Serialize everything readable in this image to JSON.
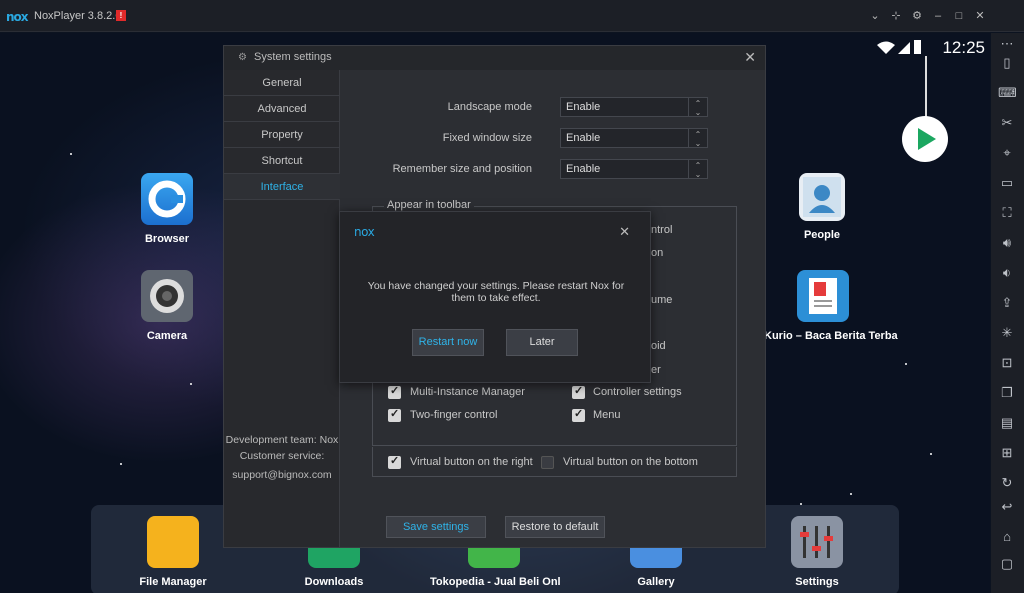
{
  "window": {
    "logo": "nox",
    "title": "NoxPlayer 3.8.2.0",
    "badge": "!"
  },
  "titlebar_buttons": [
    "chevron-down-icon",
    "pin-icon",
    "gear-icon",
    "minimize-icon",
    "maximize-icon",
    "close-icon"
  ],
  "status": {
    "time": "12:25"
  },
  "desktop_apps": [
    {
      "label": "Browser"
    },
    {
      "label": "Camera"
    },
    {
      "label": "People"
    },
    {
      "label": "Kurio – Baca Berita Terba"
    }
  ],
  "dock_apps": [
    {
      "label": "File Manager"
    },
    {
      "label": "Downloads"
    },
    {
      "label": "Tokopedia - Jual Beli Onl"
    },
    {
      "label": "Gallery"
    },
    {
      "label": "Settings"
    }
  ],
  "settings": {
    "title": "System settings",
    "nav": [
      "General",
      "Advanced",
      "Property",
      "Shortcut",
      "Interface"
    ],
    "active_nav": "Interface",
    "rows": [
      {
        "label": "Landscape mode",
        "value": "Enable"
      },
      {
        "label": "Fixed window size",
        "value": "Enable"
      },
      {
        "label": "Remember size and position",
        "value": "Enable"
      }
    ],
    "toolbar_group_title": "Appear in toolbar",
    "partial_labels": [
      "ntrol",
      "on",
      "ume",
      "oid",
      "er"
    ],
    "checkboxes": [
      {
        "label": "Multi-Instance Manager",
        "checked": true
      },
      {
        "label": "Controller settings",
        "checked": true
      },
      {
        "label": "Two-finger control",
        "checked": true
      },
      {
        "label": "Menu",
        "checked": true
      }
    ],
    "virtual_buttons": [
      {
        "label": "Virtual button on the right",
        "checked": true
      },
      {
        "label": "Virtual button on the bottom",
        "checked": false
      }
    ],
    "footer": {
      "team": "Development team: Nox",
      "service": "Customer service:",
      "email": "support@bignox.com"
    },
    "save_label": "Save settings",
    "restore_label": "Restore to default"
  },
  "dialog": {
    "logo": "nox",
    "message_line1": "You have changed your settings. Please restart Nox for",
    "message_line2": "them to take effect.",
    "restart_label": "Restart now",
    "later_label": "Later"
  },
  "colors": {
    "accent": "#2fb3e8",
    "titlebar_bg": "#1c1f26",
    "panel_bg": "#2c2e33"
  }
}
